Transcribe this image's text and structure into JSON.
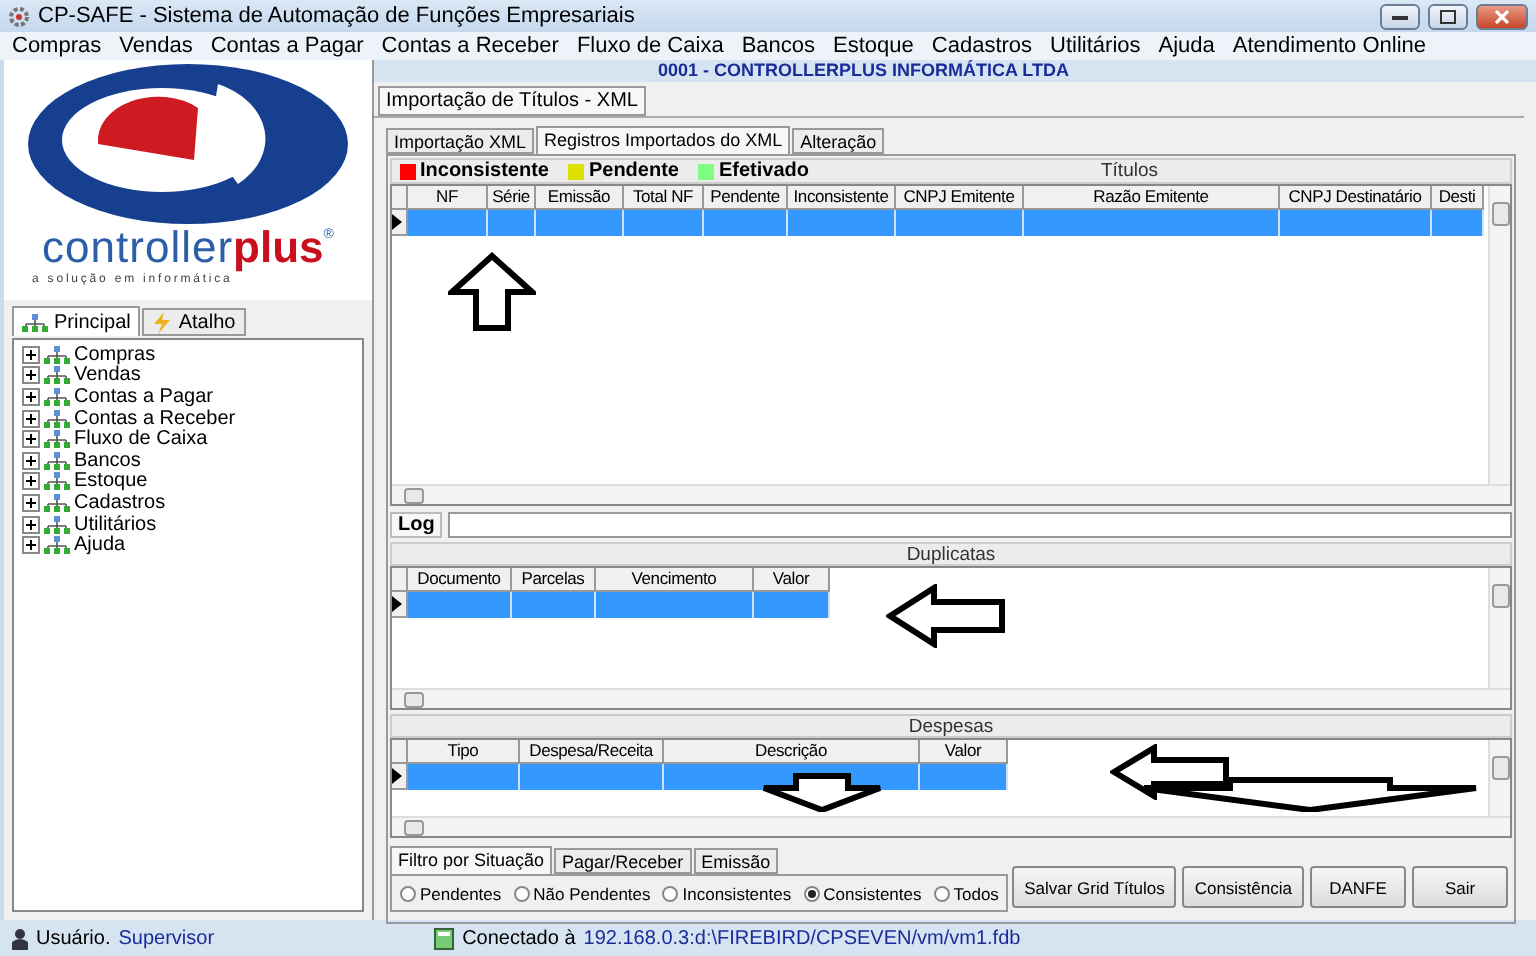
{
  "window": {
    "title": "CP-SAFE  -  Sistema de Automação de Funções Empresariais"
  },
  "menu": [
    "Compras",
    "Vendas",
    "Contas a Pagar",
    "Contas a Receber",
    "Fluxo de Caixa",
    "Bancos",
    "Estoque",
    "Cadastros",
    "Utilitários",
    "Ajuda",
    "Atendimento Online"
  ],
  "company": "0001 - CONTROLLERPLUS INFORMÁTICA LTDA",
  "logo": {
    "word_a": "controller",
    "word_b": "plus",
    "mark": "®",
    "tagline": "a solução em informática"
  },
  "side_tabs": [
    {
      "label": "Principal",
      "selected": true
    },
    {
      "label": "Atalho",
      "selected": false
    }
  ],
  "tree": [
    {
      "label": "Compras",
      "expanded": false
    },
    {
      "label": "Vendas",
      "expanded": false
    },
    {
      "label": "Contas a Pagar",
      "expanded": false
    },
    {
      "label": "Contas a Receber",
      "expanded": false
    },
    {
      "label": "Fluxo de Caixa",
      "expanded": false
    },
    {
      "label": "Bancos",
      "expanded": false
    },
    {
      "label": "Estoque",
      "expanded": false
    },
    {
      "label": "Cadastros",
      "expanded": false
    },
    {
      "label": "Utilitários",
      "expanded": false
    },
    {
      "label": "Ajuda",
      "expanded": false
    }
  ],
  "form_tab": "Importação de Títulos - XML",
  "tabs": [
    {
      "label": "Importação XML",
      "selected": false
    },
    {
      "label": "Registros Importados do XML",
      "selected": true
    },
    {
      "label": "Alteração",
      "selected": false
    }
  ],
  "legend": [
    {
      "label": "Inconsistente",
      "color": "#ff0000"
    },
    {
      "label": "Pendente",
      "color": "#e0e000"
    },
    {
      "label": "Efetivado",
      "color": "#80ff80"
    }
  ],
  "titulos": {
    "title": "Títulos",
    "columns": [
      "NF",
      "Série",
      "Emissão",
      "Total NF",
      "Pendente",
      "Inconsistente",
      "CNPJ Emitente",
      "Razão Emitente",
      "CNPJ Destinatário",
      "Desti"
    ],
    "rows": [
      {
        "selected": true
      }
    ]
  },
  "log": {
    "label": "Log"
  },
  "duplicatas": {
    "title": "Duplicatas",
    "columns": [
      "Documento",
      "Parcelas",
      "Vencimento",
      "Valor"
    ],
    "rows": [
      {
        "selected": true
      }
    ]
  },
  "despesas": {
    "title": "Despesas",
    "columns": [
      "Tipo",
      "Despesa/Receita",
      "Descrição",
      "Valor"
    ],
    "rows": [
      {
        "selected": true
      }
    ]
  },
  "filter_tabs": [
    {
      "label": "Filtro por Situação",
      "selected": true
    },
    {
      "label": "Pagar/Receber",
      "selected": false
    },
    {
      "label": "Emissão",
      "selected": false
    }
  ],
  "filter_options": [
    {
      "label": "Pendentes",
      "selected": false
    },
    {
      "label": "Não Pendentes",
      "selected": false
    },
    {
      "label": "Inconsistentes",
      "selected": false
    },
    {
      "label": "Consistentes",
      "selected": true
    },
    {
      "label": "Todos",
      "selected": false
    }
  ],
  "buttons": [
    "Salvar Grid Títulos",
    "Consistência",
    "DANFE",
    "Sair"
  ],
  "status_bar": {
    "user_label": "Usuário.",
    "user": "Supervisor",
    "conn_label": "Conectado à",
    "conn": "192.168.0.3:d:\\FIREBIRD/CPSEVEN/vm/vm1.fdb"
  }
}
